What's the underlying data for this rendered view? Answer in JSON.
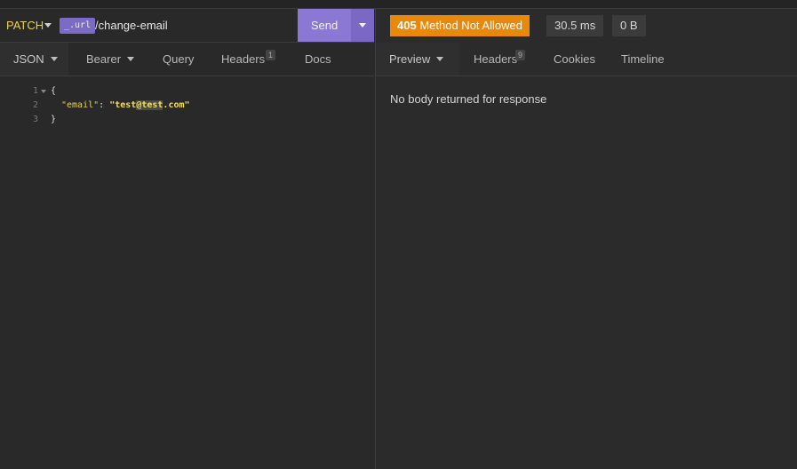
{
  "request": {
    "method": "PATCH",
    "variable_tag": "_.url",
    "path": "/change-email",
    "send_label": "Send"
  },
  "request_tabs": [
    {
      "label": "JSON"
    },
    {
      "label": "Bearer"
    },
    {
      "label": "Query"
    },
    {
      "label": "Headers",
      "badge": "1"
    },
    {
      "label": "Docs"
    }
  ],
  "editor": {
    "lines": [
      {
        "num": "1",
        "text": "{"
      },
      {
        "num": "2",
        "key": "\"email\"",
        "sep": ": ",
        "val_pre": "\"test",
        "val_sel": "@test",
        "val_post": ".com\""
      },
      {
        "num": "3",
        "text": "}"
      }
    ]
  },
  "response": {
    "status": "405 Method Not Allowed",
    "status_code": "405",
    "status_text": "Method Not Allowed",
    "time": "30.5 ms",
    "size": "0 B",
    "tabs": [
      {
        "label": "Preview"
      },
      {
        "label": "Headers",
        "badge": "9"
      },
      {
        "label": "Cookies"
      },
      {
        "label": "Timeline"
      }
    ],
    "empty_message": "No body returned for response"
  },
  "colors": {
    "accent": "#8a78d4",
    "status_warning": "#e8890c",
    "method": "#e8d15a"
  }
}
